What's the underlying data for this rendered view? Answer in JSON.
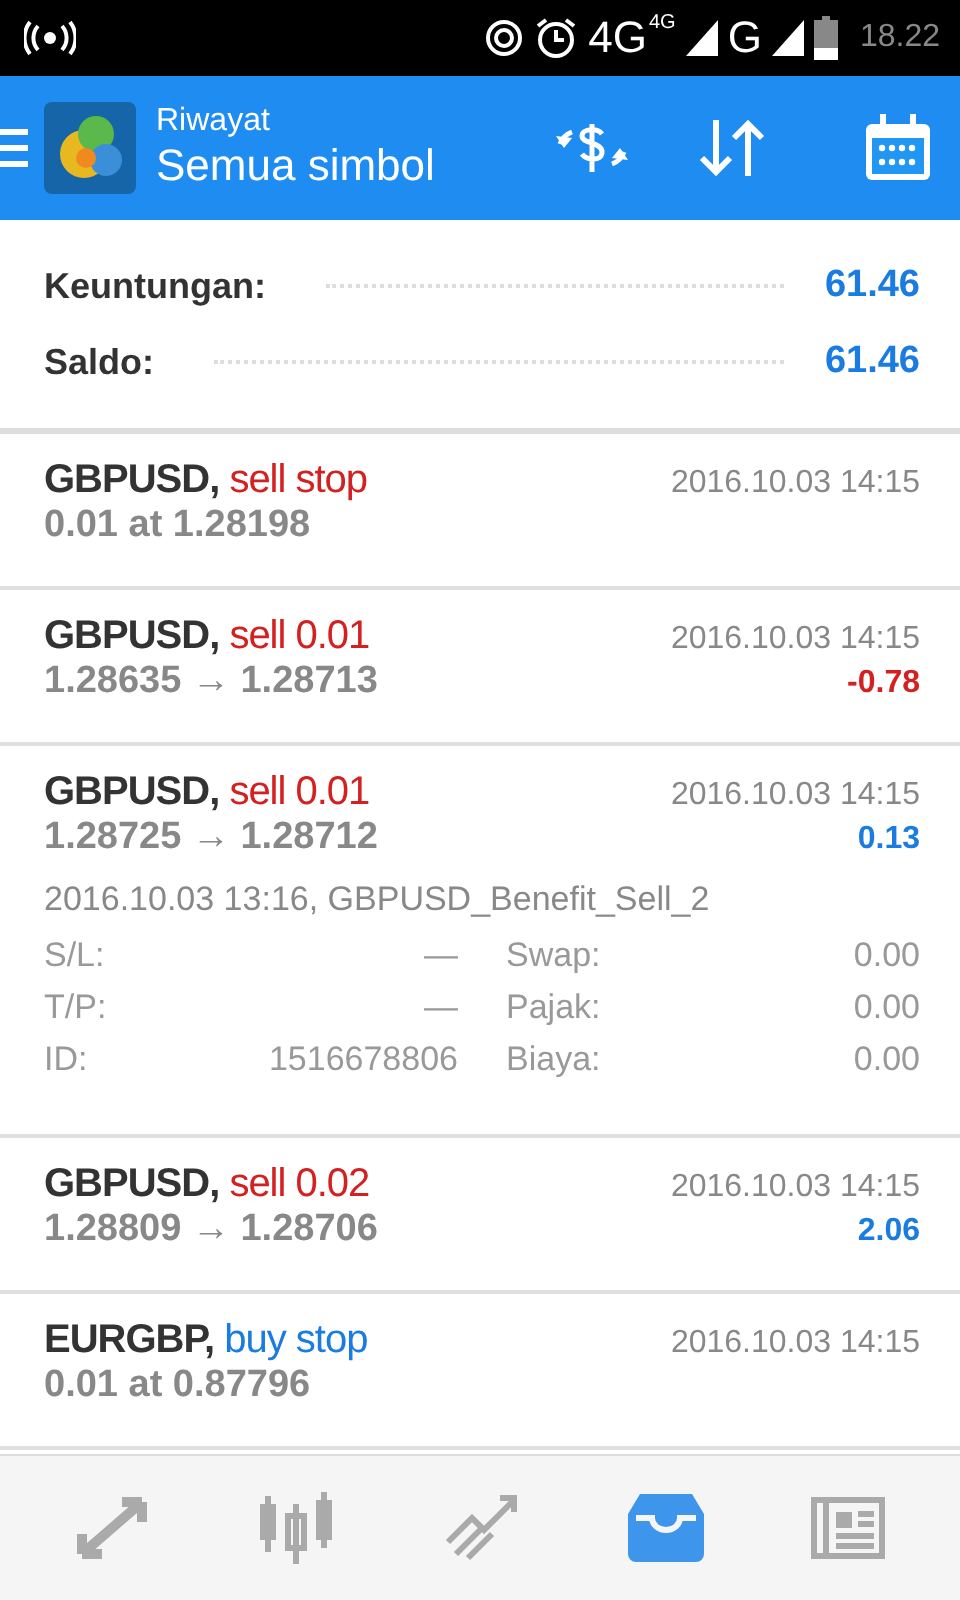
{
  "status_bar": {
    "network_4g": "4G",
    "network_4g_small": "4G",
    "network_g": "G",
    "time": "18.22"
  },
  "header": {
    "title": "Riwayat",
    "subtitle": "Semua simbol"
  },
  "summary": [
    {
      "label": "Keuntungan:",
      "value": "61.46"
    },
    {
      "label": "Saldo:",
      "value": "61.46"
    }
  ],
  "orders": [
    {
      "symbol": "GBPUSD,",
      "kind": "sell",
      "action": "sell stop",
      "time": "2016.10.03 14:15",
      "detail": "0.01 at 1.28198",
      "expanded": false
    },
    {
      "symbol": "GBPUSD,",
      "kind": "sell",
      "action": "sell 0.01",
      "time": "2016.10.03 14:15",
      "detail": "1.28635 → 1.28713",
      "profit": "-0.78",
      "loss": true,
      "expanded": false
    },
    {
      "symbol": "GBPUSD,",
      "kind": "sell",
      "action": "sell 0.01",
      "time": "2016.10.03 14:15",
      "detail": "1.28725 → 1.28712",
      "profit": "0.13",
      "loss": false,
      "expanded": true,
      "comment": "2016.10.03 13:16, GBPUSD_Benefit_Sell_2",
      "fields": [
        {
          "label": "S/L:",
          "value": "—"
        },
        {
          "label": "Swap:",
          "value": "0.00"
        },
        {
          "label": "T/P:",
          "value": "—"
        },
        {
          "label": "Pajak:",
          "value": "0.00"
        },
        {
          "label": "ID:",
          "value": "1516678806"
        },
        {
          "label": "Biaya:",
          "value": "0.00"
        }
      ]
    },
    {
      "symbol": "GBPUSD,",
      "kind": "sell",
      "action": "sell 0.02",
      "time": "2016.10.03 14:15",
      "detail": "1.28809 → 1.28706",
      "profit": "2.06",
      "loss": false,
      "expanded": false
    },
    {
      "symbol": "EURGBP,",
      "kind": "buy",
      "action": "buy stop",
      "time": "2016.10.03 14:15",
      "detail": "0.01 at 0.87796",
      "expanded": false
    }
  ],
  "nav": [
    {
      "kind": "trade",
      "selected": false
    },
    {
      "kind": "chart",
      "selected": false
    },
    {
      "kind": "quotes",
      "selected": false
    },
    {
      "kind": "history",
      "selected": true
    },
    {
      "kind": "news",
      "selected": false
    }
  ]
}
